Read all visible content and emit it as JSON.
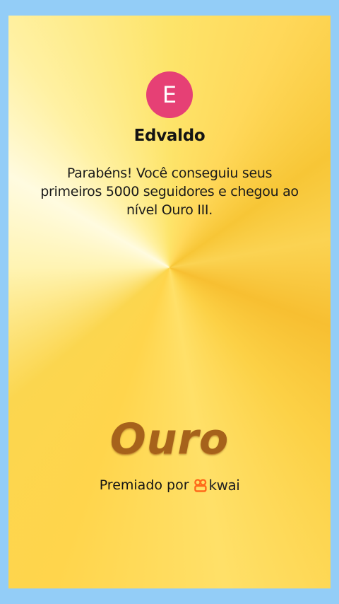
{
  "card": {
    "avatar_initial": "E",
    "username": "Edvaldo",
    "message": "Parabéns! Você conseguiu seus primeiros 5000 seguidores e chegou ao nível Ouro III.",
    "tier_title": "Ouro",
    "awarded_by_label": "Premiado por",
    "brand_name": "kwai"
  },
  "colors": {
    "background_border": "#93cdf7",
    "avatar_bg": "#e64075",
    "tier_text": "#a6621b",
    "brand_accent": "#ff6a1a"
  },
  "icons": {
    "brand_logo": "kwai-logo-icon"
  }
}
